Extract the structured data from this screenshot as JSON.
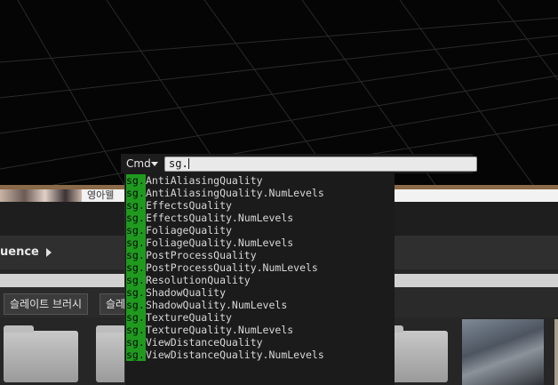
{
  "console": {
    "cmd_label": "Cmd",
    "input_value": "sg.",
    "suggestion_prefix": "sg.",
    "suggestions": [
      "AntiAliasingQuality",
      "AntiAliasingQuality.NumLevels",
      "EffectsQuality",
      "EffectsQuality.NumLevels",
      "FoliageQuality",
      "FoliageQuality.NumLevels",
      "PostProcessQuality",
      "PostProcessQuality.NumLevels",
      "ResolutionQuality",
      "ShadowQuality",
      "ShadowQuality.NumLevels",
      "TextureQuality",
      "TextureQuality.NumLevels",
      "ViewDistanceQuality",
      "ViewDistanceQuality.NumLevels"
    ]
  },
  "background": {
    "strip_text": "영아웰",
    "sequence_label": "uence",
    "path_button_1": "슬레이트 브러시",
    "path_button_2": "슬레"
  },
  "colors": {
    "viewport_bg": "#050505",
    "prefix_highlight": "#1f9a1f",
    "console_bg": "#1b1b1b"
  }
}
